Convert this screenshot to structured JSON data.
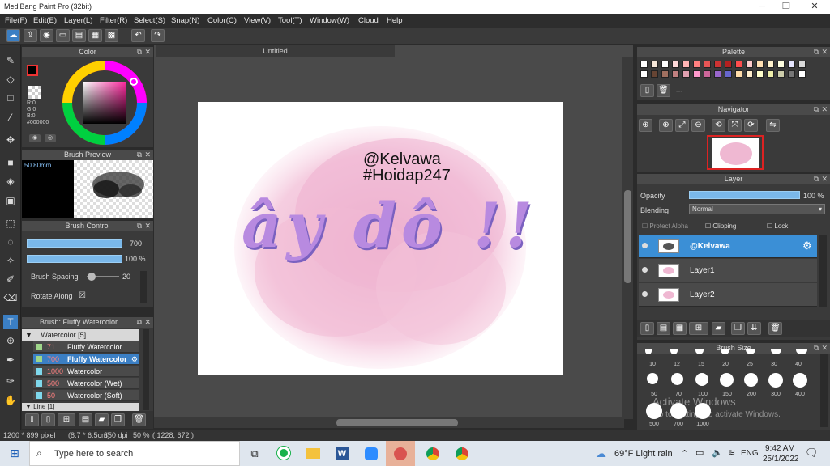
{
  "window": {
    "title": "MediBang Paint Pro (32bit)",
    "minimize": "─",
    "restore": "❐",
    "close": "✕"
  },
  "menu": [
    "File(F)",
    "Edit(E)",
    "Layer(L)",
    "Filter(R)",
    "Select(S)",
    "Snap(N)",
    "Color(C)",
    "View(V)",
    "Tool(T)",
    "Window(W)",
    "Cloud",
    "Help"
  ],
  "color_panel": {
    "title": "Color",
    "r": "R:0",
    "g": "G:0",
    "b": "B:0",
    "hex": "#000000",
    "fg": "#000000",
    "bg": "#ffffff"
  },
  "brush_preview": {
    "title": "Brush Preview",
    "size": "50.80mm"
  },
  "brush_control": {
    "title": "Brush Control",
    "size_value": "700",
    "opacity_value": "100 %",
    "opacity": 1.0,
    "spacing_label": "Brush Spacing",
    "spacing_value": "20",
    "rotate_label": "Rotate Along",
    "rotate_check": "☒"
  },
  "brush_list": {
    "title": "Brush: Fluffy Watercolor",
    "group": "Watercolor [5]",
    "items": [
      {
        "size": "71",
        "name": "Fluffy Watercolor",
        "color": "#9fd68a"
      },
      {
        "size": "700",
        "name": "Fluffy Watercolor",
        "color": "#9fd68a"
      },
      {
        "size": "1000",
        "name": "Watercolor",
        "color": "#7fd8ec"
      },
      {
        "size": "500",
        "name": "Watercolor (Wet)",
        "color": "#7fd8ec"
      },
      {
        "size": "50",
        "name": "Watercolor (Soft)",
        "color": "#7fd8ec"
      }
    ],
    "next_group": "Line [1]"
  },
  "document": {
    "tab": "Untitled",
    "text1": "@Kelvawa",
    "text2": "#Hoidap247",
    "art_text": "ây dô !!"
  },
  "status": {
    "size": "1200 * 899 pixel",
    "dims": "(8.7 * 6.5cm)",
    "dpi": "350 dpi",
    "zoom": "50 %",
    "coords": "( 1228, 672 )"
  },
  "palette": {
    "title": "Palette",
    "more": "---",
    "colors": [
      "#ffffff",
      "#f5e6d8",
      "#fdfdfd",
      "#ffd9d9",
      "#ffb3b3",
      "#ff8080",
      "#e65555",
      "#cc3333",
      "#b32020",
      "#ff4d4d",
      "#ffcccc",
      "#ffe0b3",
      "#fff2cc",
      "#ffffe0",
      "#e6e6ff",
      "#d9d9d9",
      "#ffffff",
      "#664433",
      "#a07060",
      "#c08080",
      "#e0a0b0",
      "#ff99cc",
      "#cc6699",
      "#9966cc",
      "#6666cc",
      "#ffddaa",
      "#ffeecc",
      "#ffffcc",
      "#eeeeaa",
      "#ccccaa",
      "#777777",
      "#ffffff"
    ]
  },
  "navigator": {
    "title": "Navigator"
  },
  "layer_panel": {
    "title": "Layer",
    "opacity_label": "Opacity",
    "opacity_value": "100 %",
    "opacity": 1.0,
    "blending_label": "Blending",
    "blending_value": "Normal",
    "protect_alpha": "Protect Alpha",
    "clipping": "Clipping",
    "lock": "Lock",
    "layers": [
      {
        "name": "@Kelvawa",
        "selected": true
      },
      {
        "name": "Layer1",
        "selected": false
      },
      {
        "name": "Layer2",
        "selected": false
      }
    ]
  },
  "brush_size": {
    "title": "Brush Size",
    "top_labels": [
      "10",
      "12",
      "15",
      "20",
      "25",
      "30",
      "40"
    ],
    "row2": [
      "50",
      "70",
      "100",
      "150",
      "200",
      "300",
      "400"
    ],
    "row3": [
      "500",
      "700",
      "1000"
    ]
  },
  "watermark": {
    "line1": "Activate Windows",
    "line2": "Go to Settings to activate Windows."
  },
  "taskbar": {
    "search_placeholder": "Type here to search",
    "weather": "69°F  Light rain",
    "lang": "ENG",
    "time": "9:42 AM",
    "date": "25/1/2022"
  }
}
